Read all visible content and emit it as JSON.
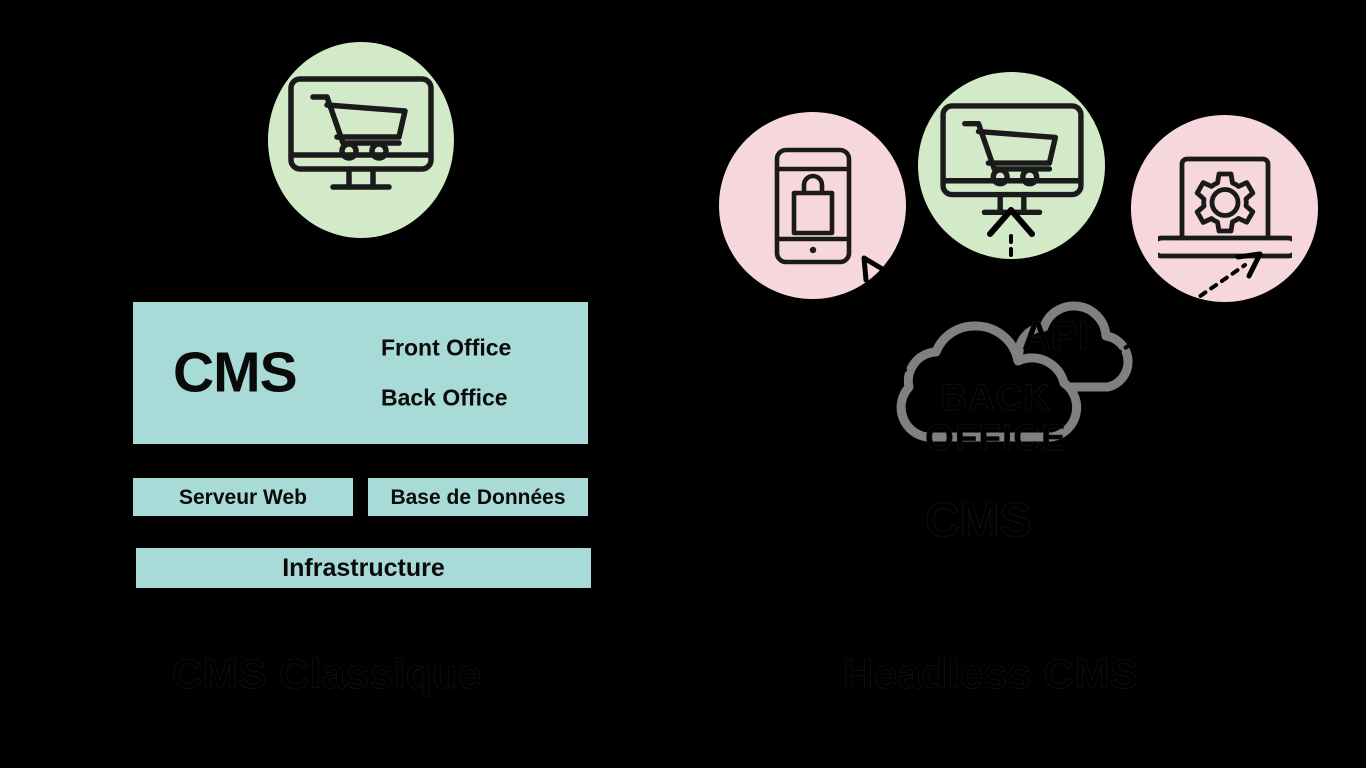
{
  "colors": {
    "background": "#000000",
    "teal_box": "#a8dbd7",
    "circle_green": "#d3eac8",
    "circle_pink": "#f6d8dc",
    "cloud_stroke": "#808080",
    "icon_stroke": "#1a1a1a",
    "arrow": "#000000",
    "text_dark": "#0a0a0a"
  },
  "left_panel": {
    "caption": "CMS Classique",
    "circle": {
      "icon": "monitor-cart-icon"
    },
    "cms_box": {
      "title": "CMS",
      "lines": [
        "Front Office",
        "Back Office"
      ]
    },
    "server_box": {
      "label": "Serveur Web"
    },
    "database_box": {
      "label": "Base de Données"
    },
    "infrastructure_box": {
      "label": "Infrastructure"
    }
  },
  "right_panel": {
    "caption": "Headless CMS",
    "cms_label": "CMS",
    "circles": [
      {
        "name": "mobile-shopping-bag",
        "icon": "mobile-bag-icon",
        "color": "#f6d8dc"
      },
      {
        "name": "desktop-shopping-cart",
        "icon": "monitor-cart-icon",
        "color": "#d3eac8"
      },
      {
        "name": "laptop-settings",
        "icon": "laptop-gear-icon",
        "color": "#f6d8dc"
      }
    ],
    "clouds": [
      {
        "name": "api-cloud",
        "label": "API"
      },
      {
        "name": "back-office-cloud",
        "label": "BACK\nOFFICE"
      }
    ],
    "arrows": [
      {
        "name": "arrow-to-mobile",
        "direction": "up-left",
        "style": "dashed"
      },
      {
        "name": "arrow-to-desktop",
        "direction": "up",
        "style": "dashed"
      },
      {
        "name": "arrow-to-laptop",
        "direction": "up-right",
        "style": "dashed"
      }
    ]
  }
}
